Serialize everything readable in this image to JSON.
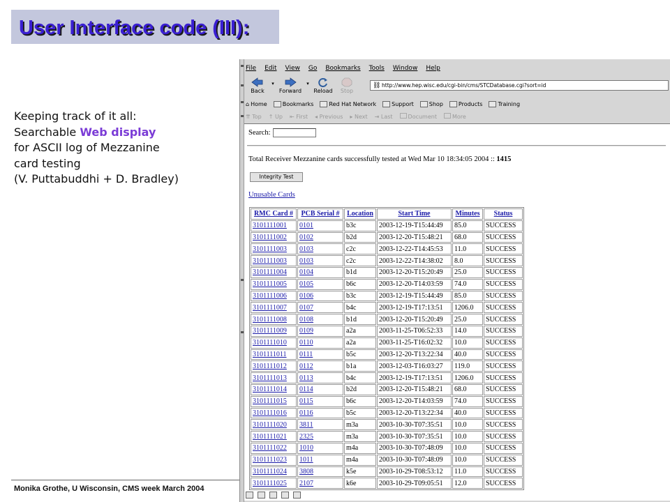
{
  "slide": {
    "title": "User Interface code (III):",
    "text_lines": {
      "l1": "Keeping track of it all:",
      "l2_prefix": "Searchable ",
      "l2_accent": "Web display",
      "l3": "for ASCII log of Mezzanine",
      "l4": "card testing",
      "l5": "(V. Puttabuddhi + D. Bradley)"
    },
    "footer": "Monika Grothe, U Wisconsin, CMS week March 2004"
  },
  "browser": {
    "menu": [
      "File",
      "Edit",
      "View",
      "Go",
      "Bookmarks",
      "Tools",
      "Window",
      "Help"
    ],
    "nav": {
      "back": "Back",
      "forward": "Forward",
      "reload": "Reload",
      "stop": "Stop"
    },
    "url": "http://www.hep.wisc.edu/cgi-bin/cms/STCDatabase.cgi?sort=id",
    "bookmarks": [
      "Home",
      "Bookmarks",
      "Red Hat Network",
      "Support",
      "Shop",
      "Products",
      "Training"
    ],
    "site_nav": [
      "Top",
      "Up",
      "First",
      "Previous",
      "Next",
      "Last",
      "Document",
      "More"
    ]
  },
  "page": {
    "search_label": "Search:",
    "summary_prefix": "Total Receiver Mezzanine cards successfully tested at Wed Mar 10 18:34:05 2004 :: ",
    "summary_count": "1415",
    "integrity_button": "Integrity Test",
    "unusable_link": "Unusable Cards",
    "table": {
      "headers": [
        "RMC Card #",
        "PCB Serial #",
        "Location",
        "Start Time",
        "Minutes",
        "Status"
      ],
      "rows": [
        [
          "3101111001",
          "0101",
          "b3c",
          "2003-12-19-T15:44:49",
          "85.0",
          "SUCCESS"
        ],
        [
          "3101111002",
          "0102",
          "b2d",
          "2003-12-20-T15:48:21",
          "68.0",
          "SUCCESS"
        ],
        [
          "3101111003",
          "0103",
          "c2c",
          "2003-12-22-T14:45:53",
          "11.0",
          "SUCCESS"
        ],
        [
          "3101111003",
          "0103",
          "c2c",
          "2003-12-22-T14:38:02",
          "8.0",
          "SUCCESS"
        ],
        [
          "3101111004",
          "0104",
          "b1d",
          "2003-12-20-T15:20:49",
          "25.0",
          "SUCCESS"
        ],
        [
          "3101111005",
          "0105",
          "b6c",
          "2003-12-20-T14:03:59",
          "74.0",
          "SUCCESS"
        ],
        [
          "3101111006",
          "0106",
          "b3c",
          "2003-12-19-T15:44:49",
          "85.0",
          "SUCCESS"
        ],
        [
          "3101111007",
          "0107",
          "b4c",
          "2003-12-19-T17:13:51",
          "1206.0",
          "SUCCESS"
        ],
        [
          "3101111008",
          "0108",
          "b1d",
          "2003-12-20-T15:20:49",
          "25.0",
          "SUCCESS"
        ],
        [
          "3101111009",
          "0109",
          "a2a",
          "2003-11-25-T06:52:33",
          "14.0",
          "SUCCESS"
        ],
        [
          "3101111010",
          "0110",
          "a2a",
          "2003-11-25-T16:02:32",
          "10.0",
          "SUCCESS"
        ],
        [
          "3101111011",
          "0111",
          "b5c",
          "2003-12-20-T13:22:34",
          "40.0",
          "SUCCESS"
        ],
        [
          "3101111012",
          "0112",
          "b1a",
          "2003-12-03-T16:03:27",
          "119.0",
          "SUCCESS"
        ],
        [
          "3101111013",
          "0113",
          "b4c",
          "2003-12-19-T17:13:51",
          "1206.0",
          "SUCCESS"
        ],
        [
          "3101111014",
          "0114",
          "b2d",
          "2003-12-20-T15:48:21",
          "68.0",
          "SUCCESS"
        ],
        [
          "3101111015",
          "0115",
          "b6c",
          "2003-12-20-T14:03:59",
          "74.0",
          "SUCCESS"
        ],
        [
          "3101111016",
          "0116",
          "b5c",
          "2003-12-20-T13:22:34",
          "40.0",
          "SUCCESS"
        ],
        [
          "3101111020",
          "3811",
          "m3a",
          "2003-10-30-T07:35:51",
          "10.0",
          "SUCCESS"
        ],
        [
          "3101111021",
          "2325",
          "m3a",
          "2003-10-30-T07:35:51",
          "10.0",
          "SUCCESS"
        ],
        [
          "3101111022",
          "1010",
          "m4a",
          "2003-10-30-T07:48:09",
          "10.0",
          "SUCCESS"
        ],
        [
          "3101111023",
          "1011",
          "m4a",
          "2003-10-30-T07:48:09",
          "10.0",
          "SUCCESS"
        ],
        [
          "3101111024",
          "3808",
          "k5e",
          "2003-10-29-T08:53:12",
          "11.0",
          "SUCCESS"
        ],
        [
          "3101111025",
          "2107",
          "k6e",
          "2003-10-29-T09:05:51",
          "12.0",
          "SUCCESS"
        ]
      ]
    }
  },
  "colors": {
    "title_text": "#3a1fd2",
    "title_bg": "#c3c7dd",
    "accent": "#7b3cd6",
    "link": "#1a1aa8",
    "chrome": "#d6d6d6"
  }
}
